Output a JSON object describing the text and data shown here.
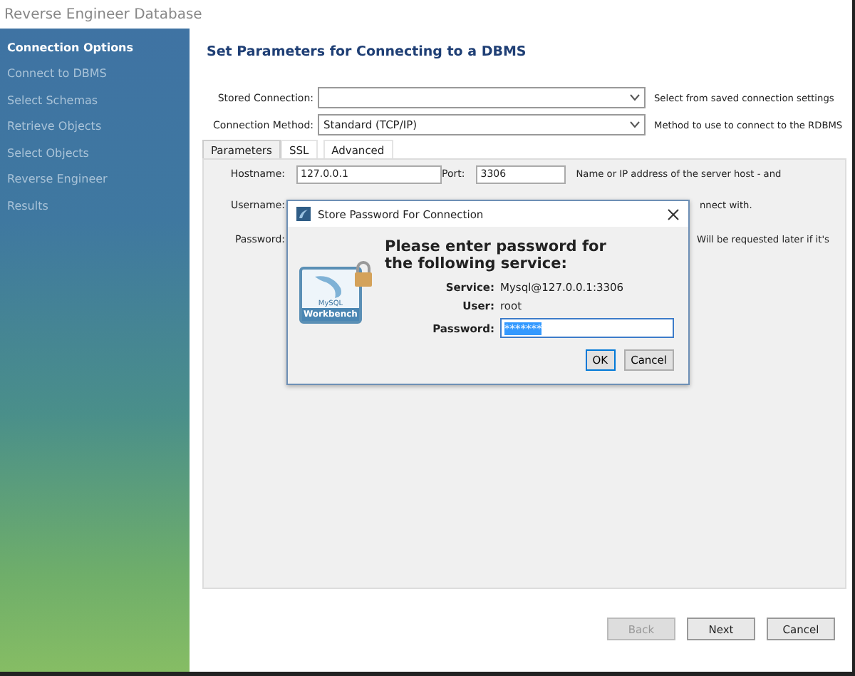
{
  "window": {
    "title": "Reverse Engineer Database"
  },
  "sidebar": {
    "items": [
      {
        "label": "Connection Options",
        "selected": true
      },
      {
        "label": "Connect to DBMS",
        "selected": false
      },
      {
        "label": "Select Schemas",
        "selected": false
      },
      {
        "label": "Retrieve Objects",
        "selected": false
      },
      {
        "label": "Select Objects",
        "selected": false
      },
      {
        "label": "Reverse Engineer",
        "selected": false
      },
      {
        "label": "Results",
        "selected": false
      }
    ]
  },
  "heading": "Set Parameters for Connecting to a DBMS",
  "fields": [
    {
      "label": "Stored Connection:",
      "help": "Select from saved connection settings"
    },
    {
      "label": "Connection Method:",
      "value": "Standard (TCP/IP)",
      "help": "Method to use to connect to the RDBMS"
    }
  ],
  "tabs": [
    {
      "label": "Parameters",
      "selected": true
    },
    {
      "label": "SSL",
      "selected": false
    },
    {
      "label": "Advanced",
      "selected": false
    }
  ],
  "parameters": {
    "hostname_label": "Hostname:",
    "hostname": "127.0.0.1",
    "port_label": "Port:",
    "port": "3306",
    "hostname_help": "Name or IP address of the server host - and",
    "username_label": "Username:",
    "username_help": "nnect with.",
    "password_label": "Password:",
    "password_help": "Will be requested later if it's"
  },
  "dialog": {
    "title": "Store Password For Connection",
    "message": "Please enter password for the following service:",
    "rows": [
      {
        "label": "Service:",
        "value": "Mysql@127.0.0.1:3306"
      },
      {
        "label": "User:",
        "value": "root"
      }
    ],
    "password_label": "Password:",
    "password": "*******",
    "logo_text_small": "MySQL",
    "logo_text": "Workbench",
    "buttons": [
      "OK",
      "Cancel"
    ]
  },
  "footer": {
    "buttons": [
      {
        "label": "Back",
        "disabled": true
      },
      {
        "label": "Next",
        "disabled": false
      },
      {
        "label": "Cancel",
        "disabled": false
      }
    ]
  }
}
